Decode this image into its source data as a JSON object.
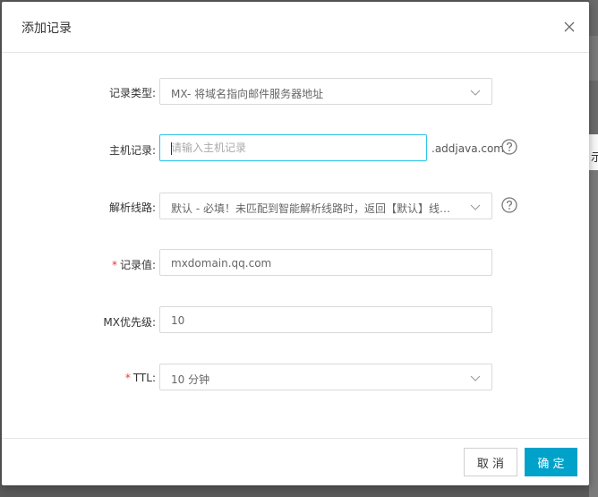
{
  "dialog": {
    "title": "添加记录",
    "close_icon": "close-icon"
  },
  "form": {
    "record_type": {
      "label": "记录类型:",
      "value": "MX- 将域名指向邮件服务器地址"
    },
    "host": {
      "label": "主机记录:",
      "placeholder": "请输入主机记录",
      "value": "",
      "suffix": ".addjava.com",
      "help_icon": "question-circle-icon"
    },
    "line": {
      "label": "解析线路:",
      "value": "默认 - 必填！未匹配到智能解析线路时，返回【默认】线路...",
      "help_icon": "question-circle-icon"
    },
    "record_value": {
      "required": "*",
      "label": "记录值:",
      "value": "mxdomain.qq.com"
    },
    "mx_priority": {
      "label": "MX优先级:",
      "value": "10"
    },
    "ttl": {
      "required": "*",
      "label": "TTL:",
      "value": "10 分钟"
    }
  },
  "footer": {
    "cancel_label": "取 消",
    "ok_label": "确 定"
  },
  "colors": {
    "accent": "#00a2ca",
    "focus_border": "#31c5e8",
    "required": "#e4393c"
  },
  "background": {
    "fragment_text": "示"
  }
}
